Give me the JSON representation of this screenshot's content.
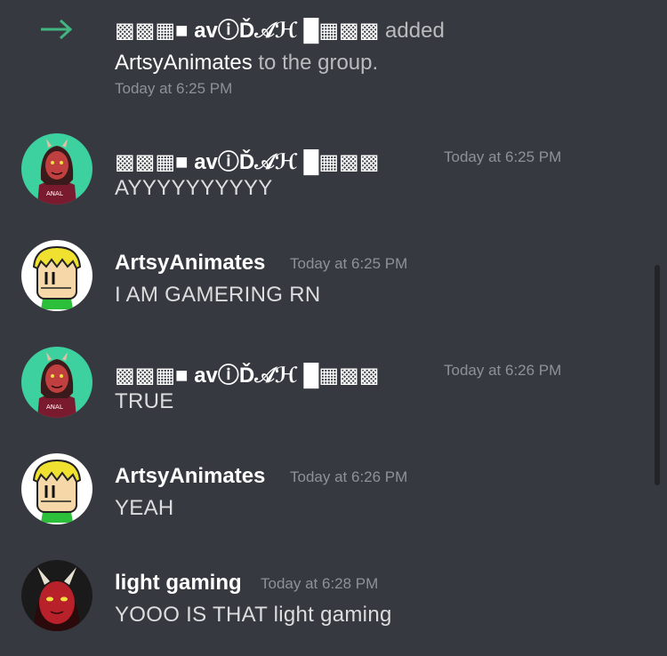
{
  "system_message": {
    "actor_name": "▩▩▦■ avⓘĎ𝒜ℋ █▦▩▩",
    "action_text": "added",
    "target_name": "ArtsyAnimates",
    "suffix_text": "to the group.",
    "timestamp": "Today at 6:25 PM",
    "icon": "join-arrow-icon"
  },
  "messages": [
    {
      "author": "▩▩▦■ avⓘĎ𝒜ℋ █▦▩▩",
      "timestamp": "Today at 6:25 PM",
      "content": "AYYYYYYYYYY",
      "avatar": "demon-girl-avatar"
    },
    {
      "author": "ArtsyAnimates",
      "timestamp": "Today at 6:25 PM",
      "content": "I AM GAMERING RN",
      "avatar": "blonde-cartoon-avatar"
    },
    {
      "author": "▩▩▦■ avⓘĎ𝒜ℋ █▦▩▩",
      "timestamp": "Today at 6:26 PM",
      "content": "TRUE",
      "avatar": "demon-girl-avatar"
    },
    {
      "author": "ArtsyAnimates",
      "timestamp": "Today at 6:26 PM",
      "content": "YEAH",
      "avatar": "blonde-cartoon-avatar"
    },
    {
      "author": "light gaming",
      "timestamp": "Today at 6:28 PM",
      "content": "YOOO IS THAT light gaming",
      "avatar": "red-demon-avatar"
    }
  ],
  "colors": {
    "background": "#36393f",
    "text": "#dcddde",
    "muted": "#8e9297",
    "join_arrow": "#43b581",
    "username": "#ffffff"
  }
}
